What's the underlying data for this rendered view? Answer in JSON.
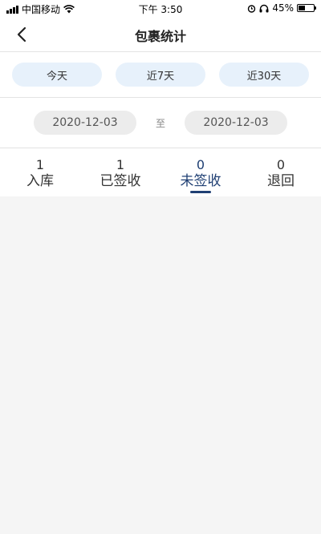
{
  "status_bar": {
    "carrier": "中国移动",
    "time": "下午 3:50",
    "battery_percent": "45%",
    "battery_level": 0.45,
    "icons": [
      "signal-icon",
      "wifi-icon",
      "alarm-icon",
      "headphones-icon",
      "battery-icon"
    ]
  },
  "nav": {
    "title": "包裹统计",
    "back_icon": "chevron-left-icon"
  },
  "quick_ranges": [
    {
      "label": "今天"
    },
    {
      "label": "近7天"
    },
    {
      "label": "近30天"
    }
  ],
  "date_range": {
    "start": "2020-12-03",
    "separator": "至",
    "end": "2020-12-03"
  },
  "tabs": [
    {
      "count": "1",
      "label": "入库",
      "active": false
    },
    {
      "count": "1",
      "label": "已签收",
      "active": false
    },
    {
      "count": "0",
      "label": "未签收",
      "active": true
    },
    {
      "count": "0",
      "label": "退回",
      "active": false
    }
  ],
  "colors": {
    "accent": "#1f3f73",
    "range_button_bg": "#e7f1fb",
    "date_pill_bg": "#ececec",
    "page_bg": "#f5f5f5"
  }
}
